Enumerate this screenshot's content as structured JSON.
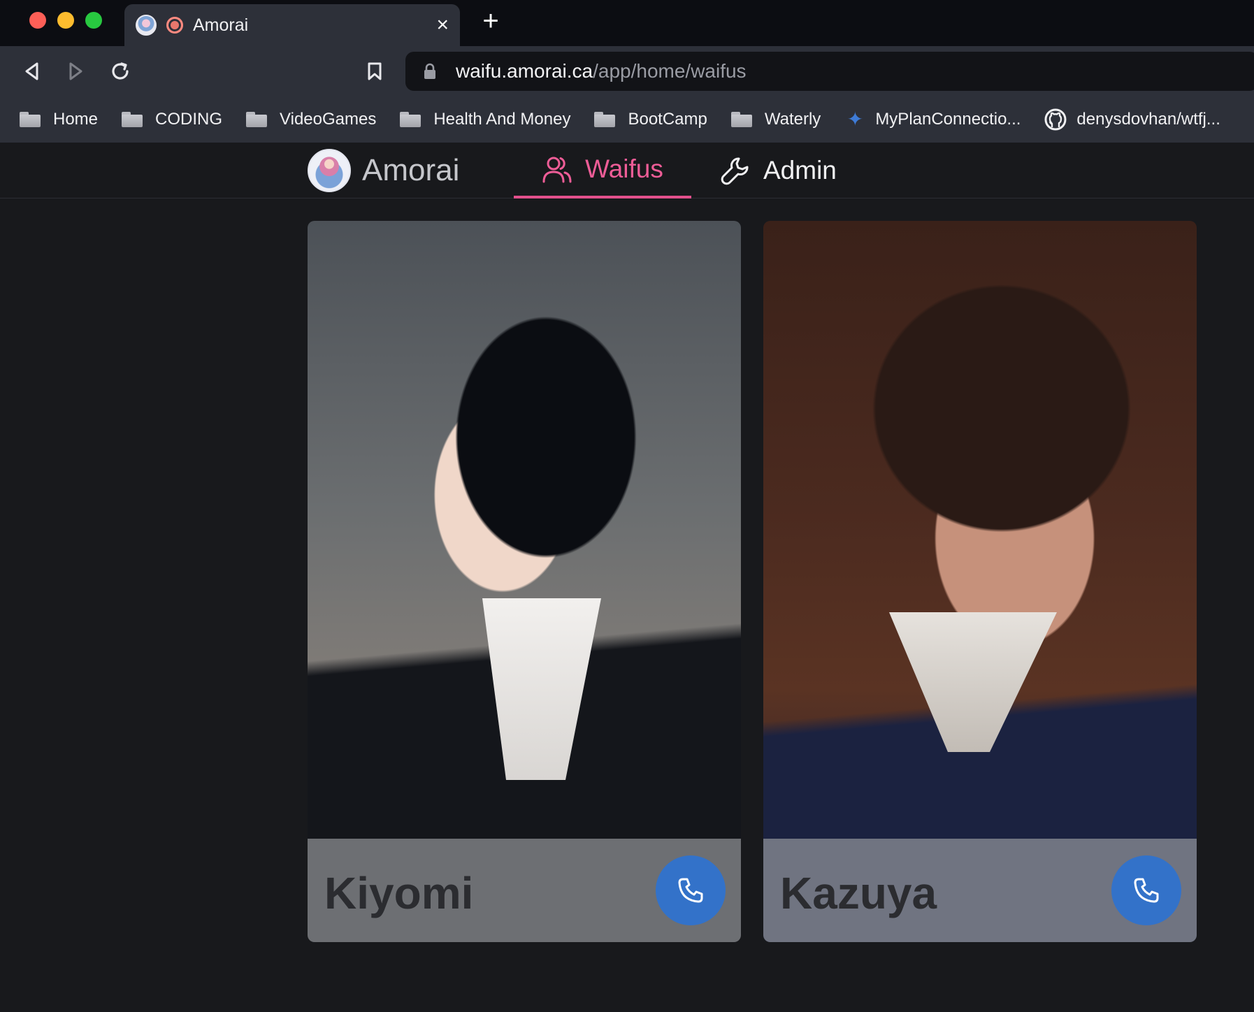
{
  "browser": {
    "tab": {
      "title": "Amorai",
      "favicon": "amorai-avatar-icon",
      "close_icon": "×"
    },
    "new_tab_icon": "+",
    "address": {
      "host": "waifu.amorai.ca",
      "path": "/app/home/waifus"
    },
    "bookmarks": [
      {
        "label": "Home",
        "icon": "folder-icon"
      },
      {
        "label": "CODING",
        "icon": "folder-icon"
      },
      {
        "label": "VideoGames",
        "icon": "folder-icon"
      },
      {
        "label": "Health And Money",
        "icon": "folder-icon"
      },
      {
        "label": "BootCamp",
        "icon": "folder-icon"
      },
      {
        "label": "Waterly",
        "icon": "folder-icon"
      },
      {
        "label": "MyPlanConnectio...",
        "icon": "sparkle-icon"
      },
      {
        "label": "denysdovhan/wtfj...",
        "icon": "github-icon"
      }
    ]
  },
  "app": {
    "brand": {
      "name": "Amorai"
    },
    "nav": {
      "waifus": {
        "label": "Waifus",
        "active": true
      },
      "admin": {
        "label": "Admin"
      }
    },
    "cards": [
      {
        "name": "Kiyomi",
        "action_icon": "phone-icon"
      },
      {
        "name": "Kazuya",
        "action_icon": "phone-icon"
      }
    ]
  },
  "colors": {
    "accent": "#ee5d97",
    "call_button": "#3372c9",
    "page_bg": "#18191c"
  }
}
